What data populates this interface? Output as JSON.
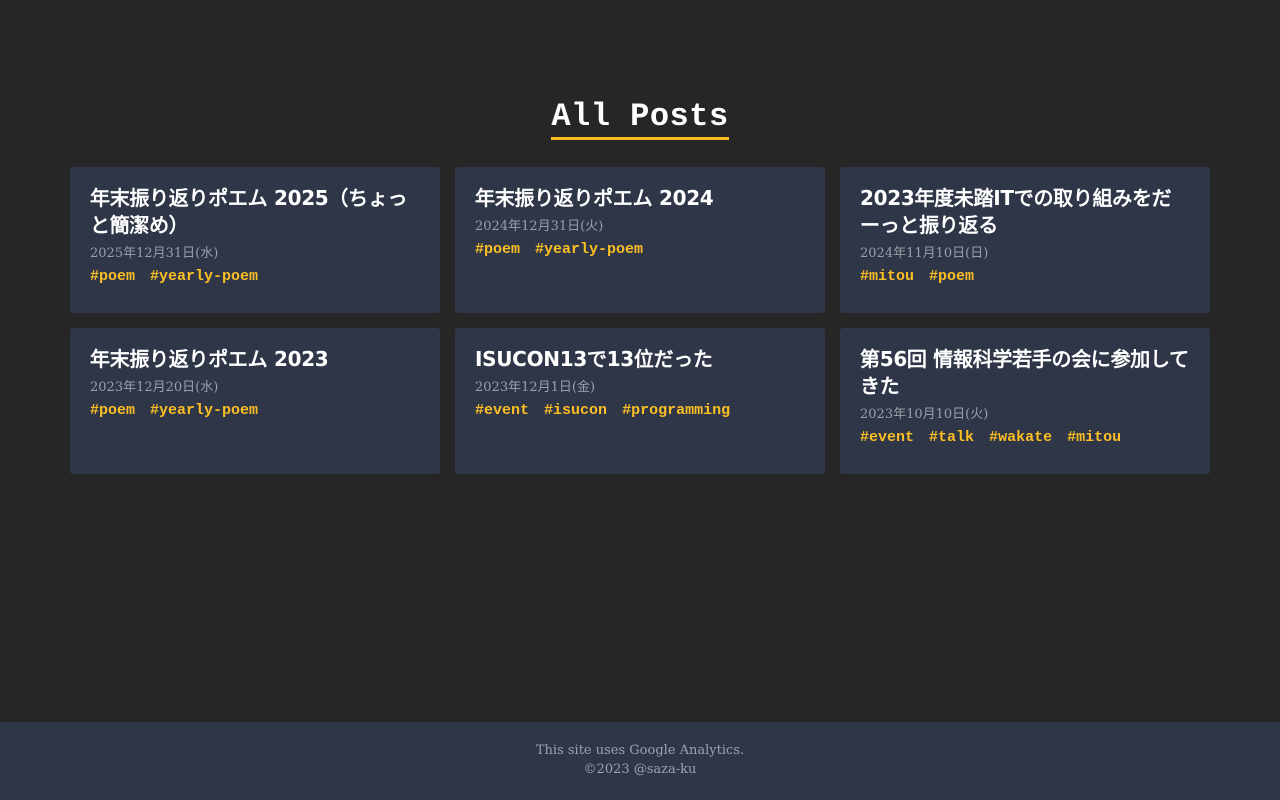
{
  "page": {
    "title": "All Posts"
  },
  "posts": [
    {
      "title": "年末振り返りポエム 2025（ちょっと簡潔め）",
      "date": "2025年12月31日(水)",
      "tags": [
        "#poem",
        "#yearly-poem"
      ]
    },
    {
      "title": "年末振り返りポエム 2024",
      "date": "2024年12月31日(火)",
      "tags": [
        "#poem",
        "#yearly-poem"
      ]
    },
    {
      "title": "2023年度未踏ITでの取り組みをだーっと振り返る",
      "date": "2024年11月10日(日)",
      "tags": [
        "#mitou",
        "#poem"
      ]
    },
    {
      "title": "年末振り返りポエム 2023",
      "date": "2023年12月20日(水)",
      "tags": [
        "#poem",
        "#yearly-poem"
      ]
    },
    {
      "title": "ISUCON13で13位だった",
      "date": "2023年12月1日(金)",
      "tags": [
        "#event",
        "#isucon",
        "#programming"
      ]
    },
    {
      "title": "第56回 情報科学若手の会に参加してきた",
      "date": "2023年10月10日(火)",
      "tags": [
        "#event",
        "#talk",
        "#wakate",
        "#mitou"
      ]
    }
  ],
  "footer": {
    "analytics_notice": "This site uses Google Analytics.",
    "copyright": "©2023 @saza-ku"
  },
  "colors": {
    "background": "#262626",
    "card": "#2e3648",
    "accent": "#fbbf24",
    "muted": "#9ca3af"
  }
}
